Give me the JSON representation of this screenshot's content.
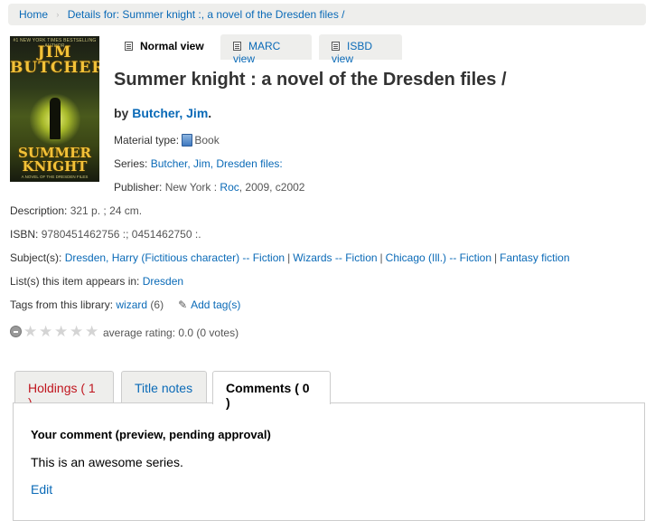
{
  "breadcrumb": {
    "home": "Home",
    "current": "Details for: Summer knight :, a novel of the Dresden files /"
  },
  "cover": {
    "blurb": "#1 NEW YORK TIMES BESTSELLING AUTHOR",
    "author_first": "JIM",
    "author_last": "BUTCHER",
    "title_line1": "SUMMER",
    "title_line2": "KNIGHT",
    "subtitle": "A NOVEL OF THE DRESDEN FILES"
  },
  "view_tabs": {
    "normal": "Normal view",
    "marc": "MARC view",
    "isbd": "ISBD view"
  },
  "record": {
    "title": "Summer knight : a novel of the Dresden files /",
    "by_prefix": "by ",
    "author": "Butcher, Jim",
    "author_suffix": ".",
    "material_type_label": "Material type: ",
    "material_type_value": "Book",
    "series_label": "Series: ",
    "series_value": "Butcher, Jim, Dresden files:",
    "publisher_label": "Publisher: ",
    "publisher_place": "New York : ",
    "publisher_name": "Roc",
    "publisher_year": ", 2009, c2002",
    "description_label": "Description: ",
    "description_value": "321 p. ; 24 cm.",
    "isbn_label": "ISBN: ",
    "isbn_value": "9780451462756 :; 0451462750 :.",
    "subjects_label": "Subject(s): ",
    "subjects": [
      "Dresden, Harry (Fictitious character) -- Fiction",
      "Wizards -- Fiction",
      "Chicago (Ill.) -- Fiction",
      "Fantasy fiction"
    ],
    "subject_separator": "|",
    "lists_label": "List(s) this item appears in: ",
    "lists_value": "Dresden",
    "tags_label": "Tags from this library: ",
    "tag_name": "wizard",
    "tag_count": " (6)",
    "add_tag": "Add tag(s)"
  },
  "rating": {
    "stars_filled": 0,
    "stars_total": 5,
    "text": "average rating: 0.0 (0 votes)"
  },
  "holdings_tabs": {
    "holdings": "Holdings ( 1 )",
    "title_notes": "Title notes",
    "comments": "Comments ( 0 )"
  },
  "comment_panel": {
    "heading": "Your comment (preview, pending approval)",
    "comment_text": "This is an awesome series.",
    "edit": "Edit"
  },
  "colors": {
    "link": "#0a6ab7",
    "holdings_tab": "#c0151e",
    "breadcrumb_bg": "#eeeeec"
  }
}
